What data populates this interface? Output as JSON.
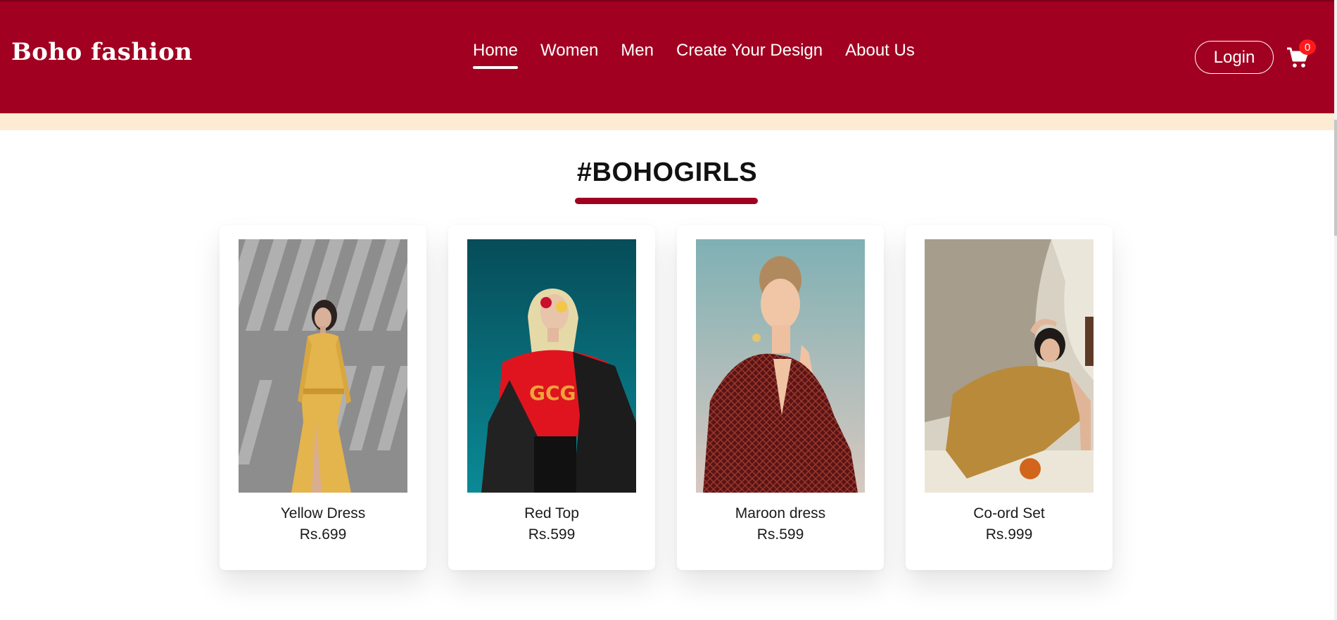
{
  "header": {
    "logo": "Boho fashion",
    "nav": [
      {
        "label": "Home",
        "active": true
      },
      {
        "label": "Women"
      },
      {
        "label": "Men"
      },
      {
        "label": "Create Your Design"
      },
      {
        "label": "About Us"
      }
    ],
    "login_label": "Login",
    "cart_icon": "cart-icon",
    "cart_count": "0"
  },
  "colors": {
    "brand": "#a10021",
    "band": "#fdebd3",
    "badge": "#ff1a1a"
  },
  "section": {
    "title": "#BOHOGIRLS"
  },
  "products": [
    {
      "name": "Yellow Dress",
      "price": "Rs.699"
    },
    {
      "name": "Red Top",
      "price": "Rs.599"
    },
    {
      "name": "Maroon dress",
      "price": "Rs.599"
    },
    {
      "name": "Co-ord Set",
      "price": "Rs.999"
    }
  ]
}
